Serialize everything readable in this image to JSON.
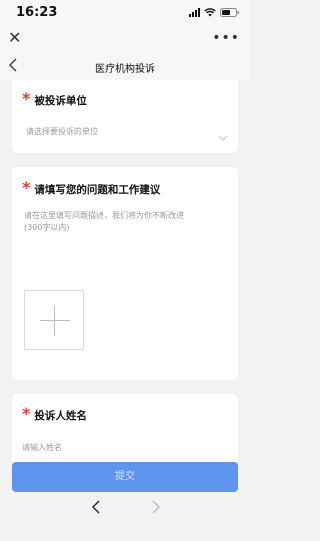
{
  "status": {
    "time": "16:23"
  },
  "nav": {
    "title": "医疗机构投诉"
  },
  "form": {
    "unit": {
      "label": "被投诉单位",
      "placeholder": "请选择要投诉的单位"
    },
    "issue": {
      "label": "请填写您的问题和工作建议",
      "hint_line1": "请在这里填写问题描述，我们将为你不断改进",
      "hint_line2": "(300字以内)"
    },
    "name": {
      "label": "投诉人姓名",
      "placeholder": "请输入姓名"
    },
    "required_mark": "*"
  },
  "submit_label": "提交",
  "colors": {
    "accent": "#5d95ee",
    "required": "#e23b2d"
  }
}
